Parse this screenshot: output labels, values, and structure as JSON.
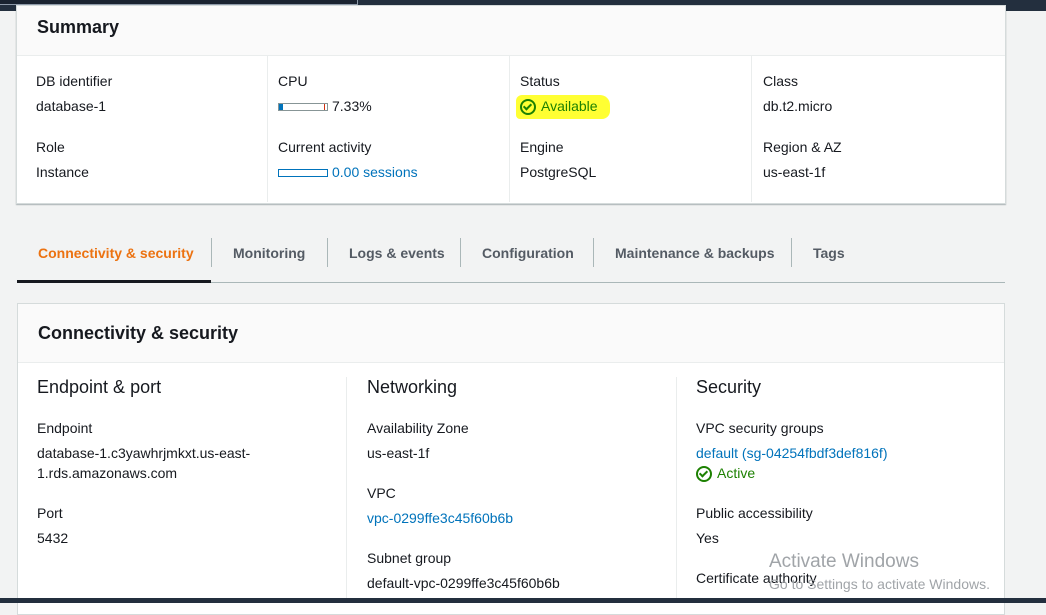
{
  "summary": {
    "title": "Summary",
    "db_identifier": {
      "label": "DB identifier",
      "value": "database-1"
    },
    "cpu": {
      "label": "CPU",
      "value": "7.33%",
      "percent": 7.33
    },
    "status": {
      "label": "Status",
      "value": "Available",
      "icon": "check-circle-icon"
    },
    "class": {
      "label": "Class",
      "value": "db.t2.micro"
    },
    "role": {
      "label": "Role",
      "value": "Instance"
    },
    "current_activity": {
      "label": "Current activity",
      "value": "0.00 sessions"
    },
    "engine": {
      "label": "Engine",
      "value": "PostgreSQL"
    },
    "region": {
      "label": "Region & AZ",
      "value": "us-east-1f"
    }
  },
  "tabs": [
    {
      "label": "Connectivity & security",
      "active": true
    },
    {
      "label": "Monitoring"
    },
    {
      "label": "Logs & events"
    },
    {
      "label": "Configuration"
    },
    {
      "label": "Maintenance & backups"
    },
    {
      "label": "Tags"
    }
  ],
  "connectivity": {
    "title": "Connectivity & security",
    "endpoint_port": {
      "title": "Endpoint & port",
      "endpoint_label": "Endpoint",
      "endpoint_line1": "database-1.c3yawhrjmkxt.us-east-",
      "endpoint_line2": "1.rds.amazonaws.com",
      "port_label": "Port",
      "port_value": "5432"
    },
    "networking": {
      "title": "Networking",
      "az_label": "Availability Zone",
      "az_value": "us-east-1f",
      "vpc_label": "VPC",
      "vpc_value": "vpc-0299ffe3c45f60b6b",
      "subnet_label": "Subnet group",
      "subnet_value": "default-vpc-0299ffe3c45f60b6b"
    },
    "security": {
      "title": "Security",
      "sg_label": "VPC security groups",
      "sg_value": "default (sg-04254fbdf3def816f)",
      "sg_status": "Active",
      "public_label": "Public accessibility",
      "public_value": "Yes",
      "cert_label": "Certificate authority"
    }
  },
  "watermark": {
    "line1": "Activate Windows",
    "line2": "Go to Settings to activate Windows."
  },
  "colors": {
    "accent": "#ec7211",
    "link": "#0073bb",
    "success": "#1d8102",
    "highlight": "#ffff33",
    "topbar": "#232f3e"
  }
}
